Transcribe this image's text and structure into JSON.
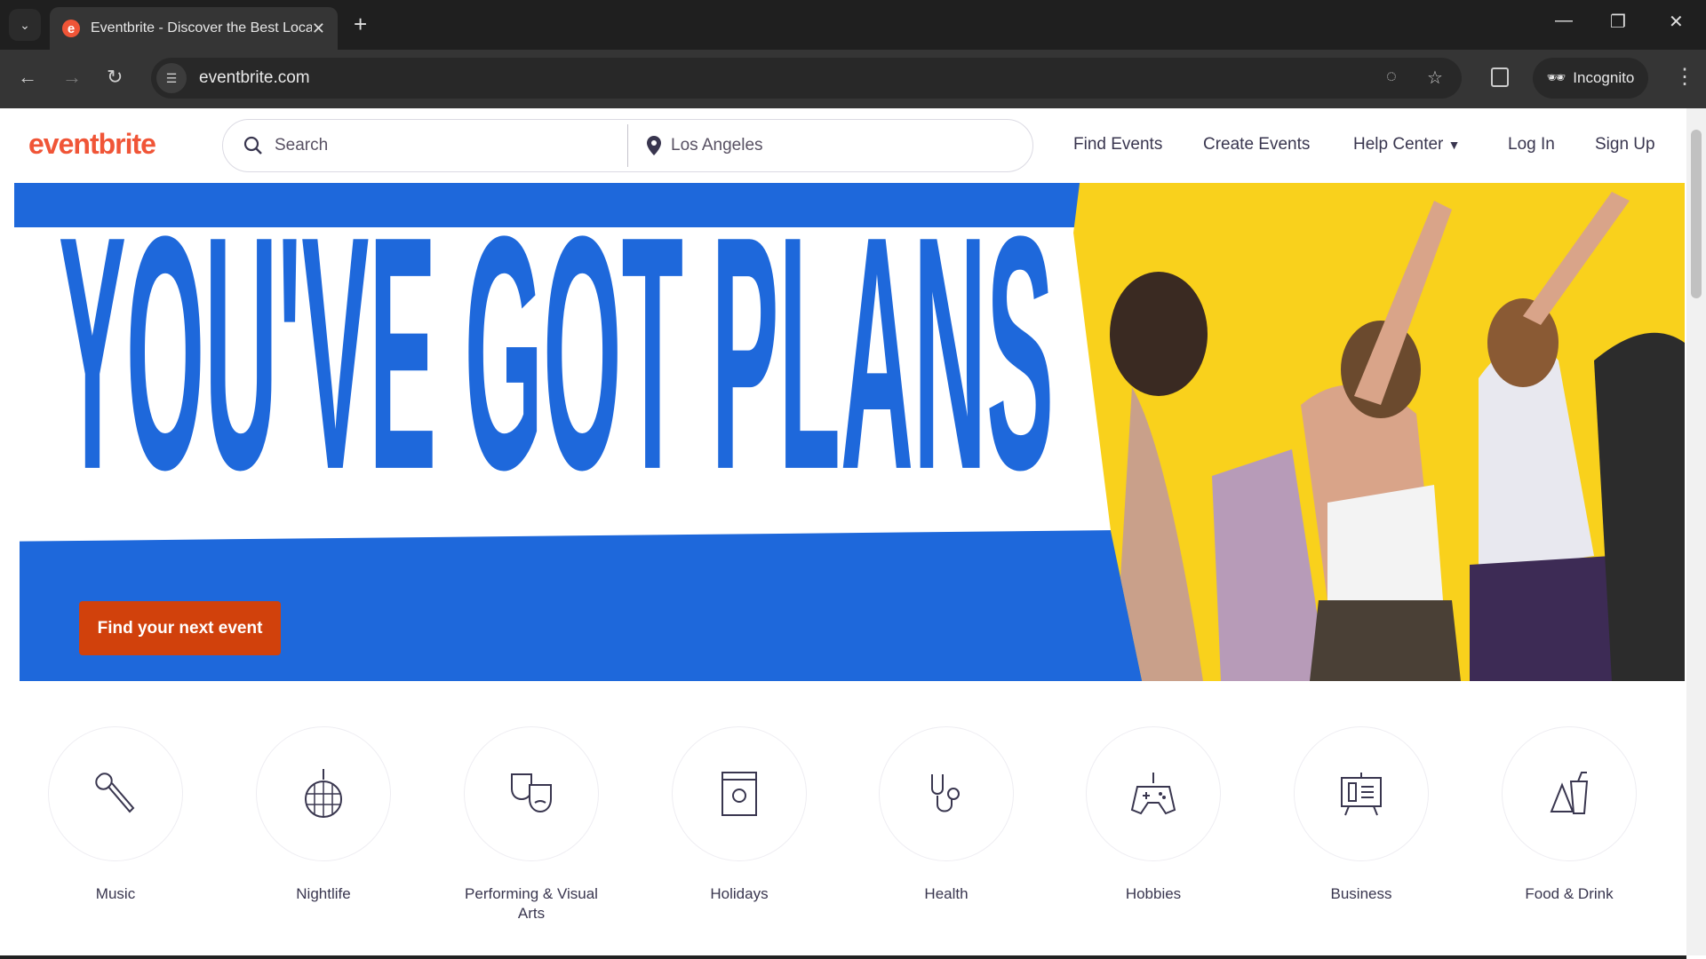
{
  "browser": {
    "tab_title": "Eventbrite - Discover the Best Local Events & Things to Do",
    "url": "eventbrite.com",
    "incognito_label": "Incognito"
  },
  "header": {
    "logo": "eventbrite",
    "search_placeholder": "Search",
    "location": "Los Angeles",
    "nav": [
      "Find Events",
      "Create Events",
      "Help Center",
      "Log In",
      "Sign Up"
    ]
  },
  "hero": {
    "headline": "YOU'VE GOT PLANS",
    "cta": "Find your next event",
    "colors": {
      "blue": "#1e68db",
      "yellow": "#f9d11c",
      "cta": "#d1410c"
    }
  },
  "categories": [
    {
      "label": "Music",
      "icon": "microphone-icon"
    },
    {
      "label": "Nightlife",
      "icon": "disco-ball-icon"
    },
    {
      "label": "Performing & Visual Arts",
      "icon": "theater-masks-icon"
    },
    {
      "label": "Holidays",
      "icon": "calendar-sun-icon"
    },
    {
      "label": "Health",
      "icon": "stethoscope-icon"
    },
    {
      "label": "Hobbies",
      "icon": "gamepad-icon"
    },
    {
      "label": "Business",
      "icon": "presentation-board-icon"
    },
    {
      "label": "Food & Drink",
      "icon": "food-drink-icon"
    }
  ]
}
